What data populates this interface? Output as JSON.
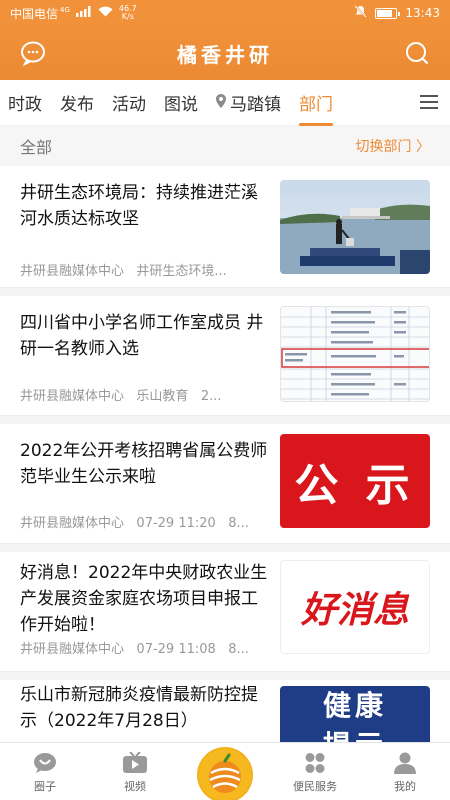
{
  "status_bar": {
    "carrier": "中国电信",
    "network": "4G",
    "speed_value": "46.7",
    "speed_unit": "K/s",
    "time": "13:43",
    "battery_level": 0.85
  },
  "header": {
    "title": "橘香井研",
    "left_icon": "chat-bubble-icon",
    "right_icon": "search-icon"
  },
  "tabs": [
    {
      "label": "时政"
    },
    {
      "label": "发布"
    },
    {
      "label": "活动"
    },
    {
      "label": "图说"
    },
    {
      "label": "马踏镇",
      "icon": "location-pin-icon"
    },
    {
      "label": "部门",
      "active": true
    }
  ],
  "filter": {
    "all_label": "全部",
    "switch_label": "切换部门 〉"
  },
  "news": [
    {
      "title": "井研生态环境局：持续推进茫溪河水质达标攻坚",
      "source": "井研县融媒体中心",
      "extra": "井研生态环境..."
    },
    {
      "title": "四川省中小学名师工作室成员 井研一名教师入选",
      "source": "井研县融媒体中心",
      "extra": "乐山教育",
      "extra2": "2..."
    },
    {
      "title": "2022年公开考核招聘省属公费师范毕业生公示来啦",
      "source": "井研县融媒体中心",
      "extra": "07-29 11:20",
      "extra2": "8...",
      "thumb_text": "公 示"
    },
    {
      "title": "好消息！2022年中央财政农业生产发展资金家庭农场项目申报工作开始啦！",
      "source": "井研县融媒体中心",
      "extra": "07-29 11:08",
      "extra2": "8...",
      "thumb_text": "好消息"
    },
    {
      "title": "乐山市新冠肺炎疫情最新防控提示（2022年7月28日）",
      "thumb_text_top": "健康",
      "thumb_text_bottom": "提示"
    }
  ],
  "bottom_nav": [
    {
      "label": "圈子",
      "icon": "chat-circle-icon"
    },
    {
      "label": "视频",
      "icon": "tv-icon"
    },
    {
      "label": "",
      "icon": "center-logo-icon"
    },
    {
      "label": "便民服务",
      "icon": "grid-service-icon"
    },
    {
      "label": "我的",
      "icon": "user-icon"
    }
  ],
  "colors": {
    "brand": "#ef8a34",
    "red": "#d9161c",
    "navy": "#1f3d87"
  }
}
